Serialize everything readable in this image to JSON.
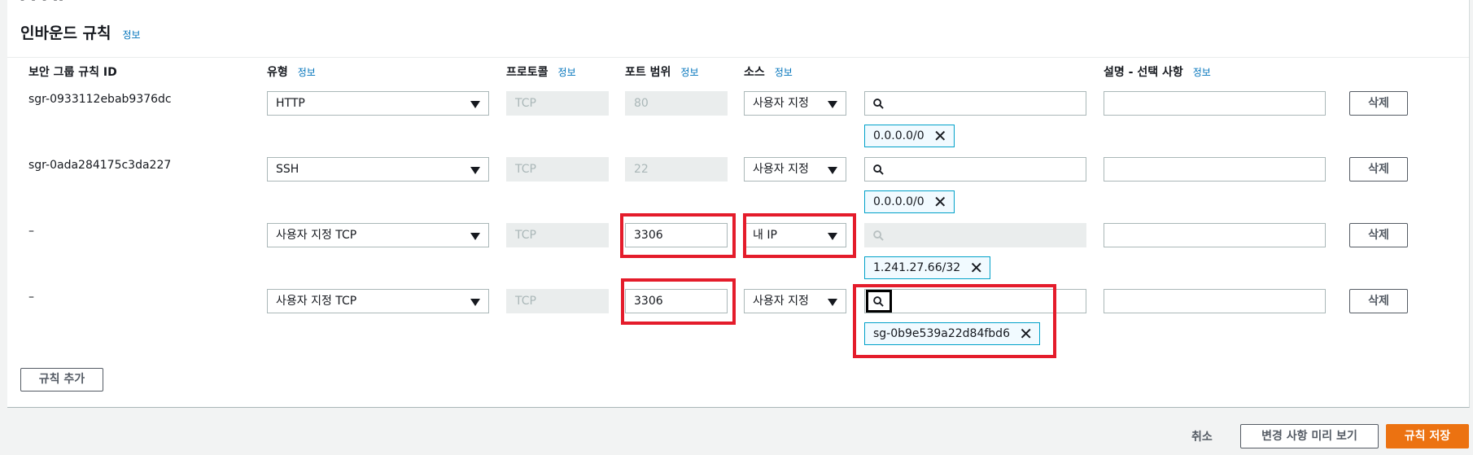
{
  "panel": {
    "clipped_text": "- -   - --",
    "title": "인바운드 규칙",
    "title_info": "정보"
  },
  "columns": {
    "rule_id": "보안 그룹 규칙 ID",
    "type": "유형",
    "type_info": "정보",
    "protocol": "프로토콜",
    "protocol_info": "정보",
    "port": "포트 범위",
    "port_info": "정보",
    "source": "소스",
    "source_info": "정보",
    "desc": "설명 - 선택 사항",
    "desc_info": "정보"
  },
  "rules": [
    {
      "id": "sgr-0933112ebab9376dc",
      "type": "HTTP",
      "protocol": "TCP",
      "port": "80",
      "source": "사용자 지정",
      "chip": "0.0.0.0/0",
      "delete": "삭제"
    },
    {
      "id": "sgr-0ada284175c3da227",
      "type": "SSH",
      "protocol": "TCP",
      "port": "22",
      "source": "사용자 지정",
      "chip": "0.0.0.0/0",
      "delete": "삭제"
    },
    {
      "id": "–",
      "type": "사용자 지정 TCP",
      "protocol": "TCP",
      "port": "3306",
      "source": "내 IP",
      "chip": "1.241.27.66/32",
      "delete": "삭제"
    },
    {
      "id": "–",
      "type": "사용자 지정 TCP",
      "protocol": "TCP",
      "port": "3306",
      "source": "사용자 지정",
      "chip": "sg-0b9e539a22d84fbd6",
      "delete": "삭제"
    }
  ],
  "add_rule": "규칙 추가",
  "footer": {
    "cancel": "취소",
    "preview": "변경 사항 미리 보기",
    "save": "규칙 저장"
  },
  "colors": {
    "accent": "#ec7211",
    "link": "#0073bb",
    "highlight": "#e41c2b",
    "chip_border": "#00a1c9"
  }
}
